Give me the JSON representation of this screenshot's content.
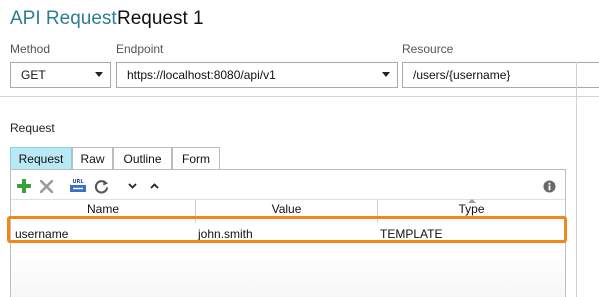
{
  "header": {
    "type_label": "API Request",
    "request_name": "Request 1"
  },
  "fields": {
    "method": {
      "label": "Method",
      "value": "GET"
    },
    "endpoint": {
      "label": "Endpoint",
      "value": "https://localhost:8080/api/v1"
    },
    "resource": {
      "label": "Resource",
      "value": "/users/{username}"
    }
  },
  "request": {
    "section_label": "Request",
    "tabs": [
      {
        "label": "Request",
        "active": true
      },
      {
        "label": "Raw",
        "active": false
      },
      {
        "label": "Outline",
        "active": false
      },
      {
        "label": "Form",
        "active": false
      }
    ],
    "toolbar": {
      "icons": [
        "add-icon",
        "delete-icon",
        "url-encode-icon",
        "refresh-icon",
        "move-down-icon",
        "move-up-icon",
        "info-icon"
      ]
    },
    "table": {
      "columns": [
        "Name",
        "Value",
        "Type"
      ],
      "rows": [
        {
          "name": "username",
          "value": "john.smith",
          "type": "TEMPLATE"
        }
      ]
    }
  },
  "colors": {
    "title_accent": "#2b7f8e",
    "active_tab": "#b9e9f5",
    "highlight": "#f0861c",
    "add_green": "#3aa03a"
  }
}
